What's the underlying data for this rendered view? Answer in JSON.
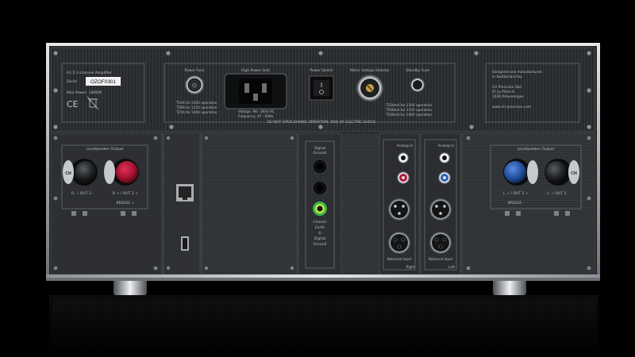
{
  "top": {
    "model": "A1.5 2-channel Amplifier",
    "serial_label": "Serial",
    "serial_value": "OZOF0301",
    "max_power": "Max Power: 1800W",
    "power_fuse_title": "Power Fuse",
    "fuse_lines": [
      "T10A for 230V operation",
      "T20A for 115V operation",
      "T25A for 100V operation"
    ],
    "power_inlet_title": "High Power Inlet",
    "voltage_line": "Voltage: 98 - 264V AC",
    "frequency_line": "Frequency: 47 - 63Hz",
    "power_switch_title": "Power Switch",
    "mains_selector_title": "Mains Voltage Selector",
    "standby_fuse_title": "Standby Fuse",
    "standby_lines": [
      "T250mA for 230V operation",
      "T500mA for 115V operation",
      "T500mA for 100V operation"
    ],
    "warning": "DO NOT OPEN DURING OPERATION. RISK OF ELECTRIC SHOCK",
    "maker_lines": [
      "Designed and manufactured",
      "in Switzerland by",
      "CH Precision Sàrl",
      "ZI La Pièce 6",
      "1026 Préverenges",
      "www.ch-precision.com"
    ]
  },
  "left_output": {
    "title": "Loudspeaker Output",
    "label_left": "R - / OUT 2 -",
    "label_right": "R + / OUT 2 +",
    "bridge": "BRIDGE +",
    "logo": "CH"
  },
  "right_output": {
    "title": "Loudspeaker Output",
    "label_left": "L + / OUT 1 +",
    "label_right": "L - / OUT 1 -",
    "bridge": "BRIDGE -",
    "logo": "CH"
  },
  "ground": {
    "title_lines": [
      "Signal",
      "Ground"
    ],
    "chassis_lines": [
      "Chassis",
      "Earth",
      "&",
      "Digital",
      "Ground"
    ]
  },
  "analog_left": {
    "title": "Analog In",
    "balanced": "Balanced Input",
    "side": "Right"
  },
  "analog_right": {
    "title": "Analog In",
    "balanced": "Balanced Input",
    "side": "Left"
  },
  "colors": {
    "chassis": "#2a2c2f",
    "silver_frame": "#c9ccd0",
    "red_terminal": "#b3153a",
    "blue_terminal": "#2a5fb8",
    "green_ground": "#39b54a",
    "background": "#000000"
  }
}
